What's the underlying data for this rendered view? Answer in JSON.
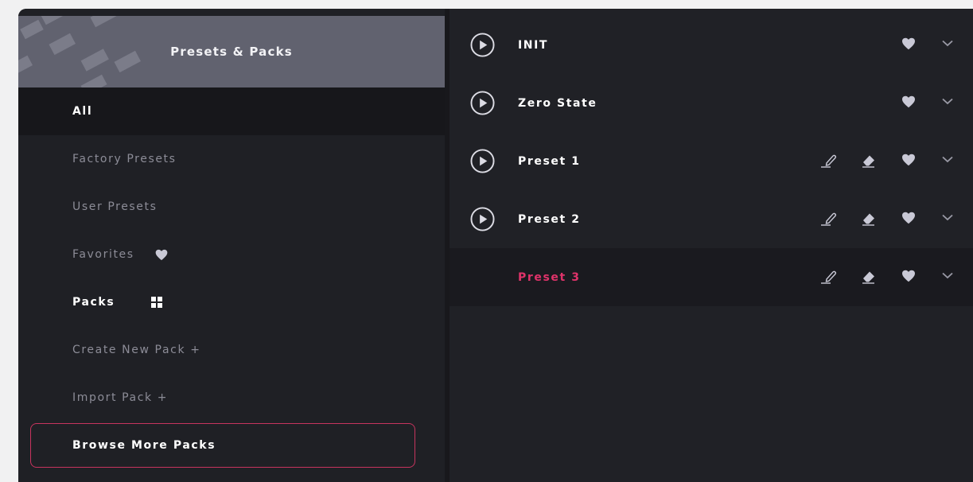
{
  "sidebar": {
    "title": "Presets & Packs",
    "items": [
      {
        "label": "All",
        "state": "active"
      },
      {
        "label": "Factory Presets"
      },
      {
        "label": "User Presets"
      },
      {
        "label": "Favorites",
        "icon": "heart-icon"
      },
      {
        "label": "Packs",
        "icon": "grid-icon"
      },
      {
        "label": "Create New Pack +"
      },
      {
        "label": "Import Pack +"
      }
    ],
    "browse_button": "Browse More Packs"
  },
  "presets": [
    {
      "name": "INIT",
      "actions": [
        "play-icon",
        "heart-icon",
        "chevron-down-icon"
      ]
    },
    {
      "name": "Zero State",
      "actions": [
        "play-icon",
        "heart-icon",
        "chevron-down-icon"
      ]
    },
    {
      "name": "Preset 1",
      "actions": [
        "play-icon",
        "pencil-icon",
        "eraser-icon",
        "heart-icon",
        "chevron-down-icon"
      ]
    },
    {
      "name": "Preset 2",
      "actions": [
        "play-icon",
        "pencil-icon",
        "eraser-icon",
        "heart-icon",
        "chevron-down-icon"
      ]
    },
    {
      "name": "Preset 3",
      "selected": true,
      "actions": [
        "pencil-icon",
        "eraser-icon",
        "heart-icon",
        "chevron-down-icon"
      ]
    }
  ],
  "colors": {
    "accent": "#e0336a",
    "border_accent": "#c7345e",
    "panel_bg": "#1f2025",
    "header_bg": "#61626f"
  }
}
